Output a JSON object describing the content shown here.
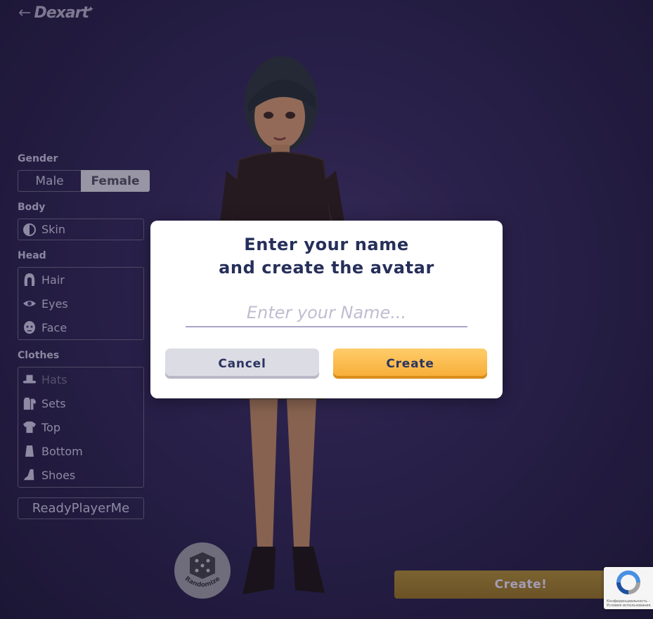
{
  "header": {
    "back_icon": "arrow-left-icon",
    "logo_text": "Dexart"
  },
  "panel": {
    "gender_label": "Gender",
    "gender_options": [
      "Male",
      "Female"
    ],
    "gender_selected": "Female",
    "body_label": "Body",
    "body_items": [
      {
        "label": "Skin",
        "icon": "half-circle-icon"
      }
    ],
    "head_label": "Head",
    "head_items": [
      {
        "label": "Hair",
        "icon": "hair-icon"
      },
      {
        "label": "Eyes",
        "icon": "eye-icon"
      },
      {
        "label": "Face",
        "icon": "face-icon"
      }
    ],
    "clothes_label": "Clothes",
    "clothes_items": [
      {
        "label": "Hats",
        "icon": "hat-icon",
        "disabled": true
      },
      {
        "label": "Sets",
        "icon": "outfit-set-icon"
      },
      {
        "label": "Top",
        "icon": "tshirt-icon"
      },
      {
        "label": "Bottom",
        "icon": "skirt-icon"
      },
      {
        "label": "Shoes",
        "icon": "heel-shoe-icon"
      }
    ],
    "rpm_label": "ReadyPlayerMe"
  },
  "randomize": {
    "label": "Randomize",
    "icon": "dice-icon"
  },
  "create_main_label": "Create!",
  "recaptcha": {
    "icon": "recaptcha-icon",
    "text": "Конфиденциальность - Условия использования"
  },
  "modal": {
    "title_line1": "Enter your name",
    "title_line2": "and create the avatar",
    "name_placeholder": "Enter your Name...",
    "name_value": "",
    "cancel_label": "Cancel",
    "create_label": "Create"
  },
  "colors": {
    "accent": "#f6ac34",
    "title_text": "#262f5a",
    "background": "#2e2553"
  }
}
